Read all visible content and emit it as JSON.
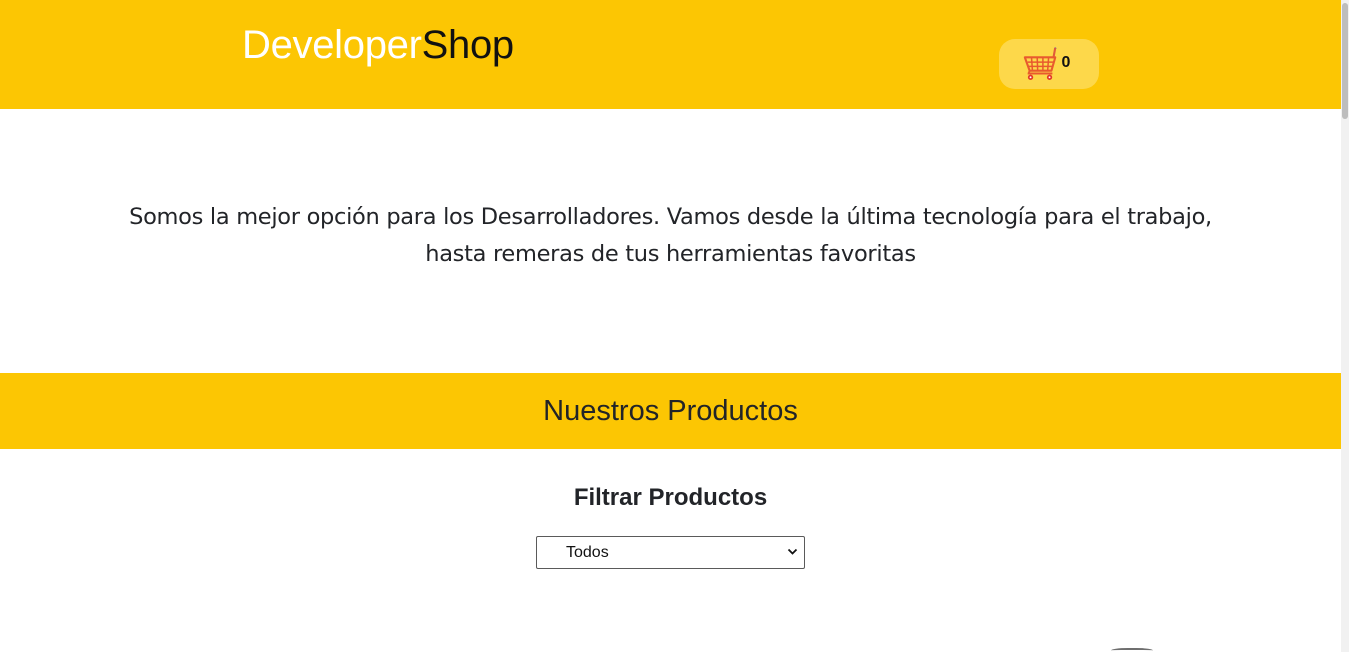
{
  "header": {
    "logo_part1": "Developer",
    "logo_part2": "Shop",
    "cart_icon": "shopping-cart-icon",
    "cart_count": "0",
    "background_color": "#fcc603"
  },
  "intro": {
    "line1": "Somos la mejor opción para los Desarrolladores. Vamos desde la última tecnología para el trabajo,",
    "line2": "hasta remeras de tus herramientas favoritas"
  },
  "products": {
    "title": "Nuestros Productos"
  },
  "filter": {
    "title": "Filtrar Productos",
    "selected": "Todos",
    "chevron_icon": "chevron-down-icon"
  }
}
